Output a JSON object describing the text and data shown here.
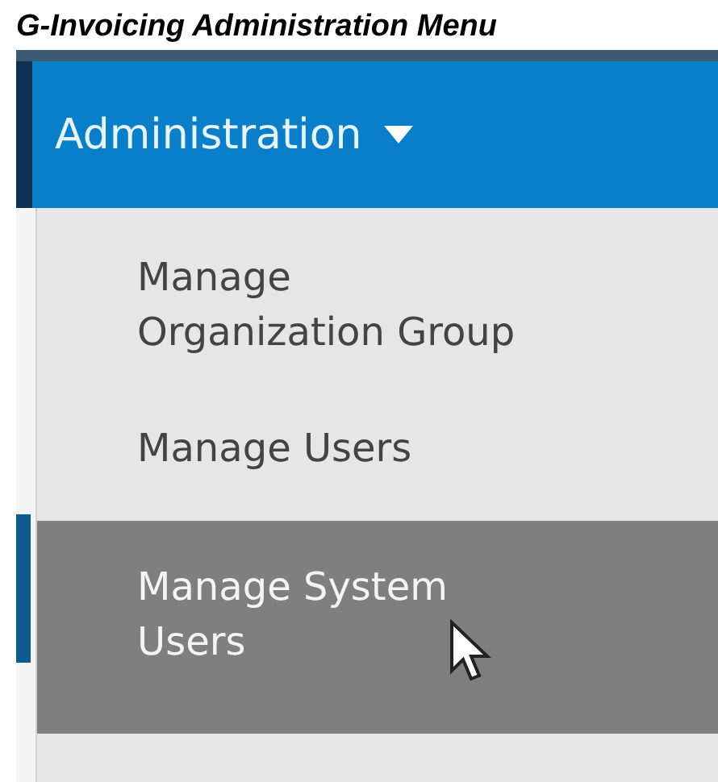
{
  "caption": "G-Invoicing Administration Menu",
  "menu_button": {
    "label": "Administration",
    "expanded": true
  },
  "menu_items": [
    {
      "label": "Manage Organization Group",
      "selected": false
    },
    {
      "label": "Manage Users",
      "selected": false
    },
    {
      "label": "Manage System Users",
      "selected": true
    }
  ]
}
